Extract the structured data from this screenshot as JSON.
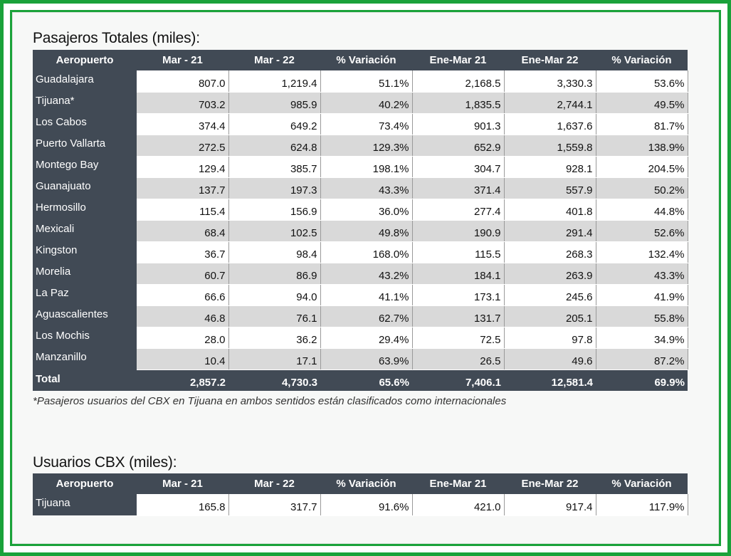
{
  "table1": {
    "title": "Pasajeros Totales (miles):",
    "headers": [
      "Aeropuerto",
      "Mar - 21",
      "Mar - 22",
      "% Variación",
      "Ene-Mar 21",
      "Ene-Mar 22",
      "% Variación"
    ],
    "rows": [
      [
        "Guadalajara",
        "807.0",
        "1,219.4",
        "51.1%",
        "2,168.5",
        "3,330.3",
        "53.6%"
      ],
      [
        "Tijuana*",
        "703.2",
        "985.9",
        "40.2%",
        "1,835.5",
        "2,744.1",
        "49.5%"
      ],
      [
        "Los Cabos",
        "374.4",
        "649.2",
        "73.4%",
        "901.3",
        "1,637.6",
        "81.7%"
      ],
      [
        "Puerto Vallarta",
        "272.5",
        "624.8",
        "129.3%",
        "652.9",
        "1,559.8",
        "138.9%"
      ],
      [
        "Montego Bay",
        "129.4",
        "385.7",
        "198.1%",
        "304.7",
        "928.1",
        "204.5%"
      ],
      [
        "Guanajuato",
        "137.7",
        "197.3",
        "43.3%",
        "371.4",
        "557.9",
        "50.2%"
      ],
      [
        "Hermosillo",
        "115.4",
        "156.9",
        "36.0%",
        "277.4",
        "401.8",
        "44.8%"
      ],
      [
        "Mexicali",
        "68.4",
        "102.5",
        "49.8%",
        "190.9",
        "291.4",
        "52.6%"
      ],
      [
        "Kingston",
        "36.7",
        "98.4",
        "168.0%",
        "115.5",
        "268.3",
        "132.4%"
      ],
      [
        "Morelia",
        "60.7",
        "86.9",
        "43.2%",
        "184.1",
        "263.9",
        "43.3%"
      ],
      [
        "La Paz",
        "66.6",
        "94.0",
        "41.1%",
        "173.1",
        "245.6",
        "41.9%"
      ],
      [
        "Aguascalientes",
        "46.8",
        "76.1",
        "62.7%",
        "131.7",
        "205.1",
        "55.8%"
      ],
      [
        "Los Mochis",
        "28.0",
        "36.2",
        "29.4%",
        "72.5",
        "97.8",
        "34.9%"
      ],
      [
        "Manzanillo",
        "10.4",
        "17.1",
        "63.9%",
        "26.5",
        "49.6",
        "87.2%"
      ]
    ],
    "total": [
      "Total",
      "2,857.2",
      "4,730.3",
      "65.6%",
      "7,406.1",
      "12,581.4",
      "69.9%"
    ],
    "footnote": "*Pasajeros usuarios del CBX en Tijuana en ambos sentidos están clasificados como internacionales"
  },
  "table2": {
    "title": "Usuarios CBX (miles):",
    "headers": [
      "Aeropuerto",
      "Mar - 21",
      "Mar - 22",
      "% Variación",
      "Ene-Mar 21",
      "Ene-Mar 22",
      "% Variación"
    ],
    "rows": [
      [
        "Tijuana",
        "165.8",
        "317.7",
        "91.6%",
        "421.0",
        "917.4",
        "117.9%"
      ]
    ]
  },
  "colors": {
    "frame_green": "#1aa23a",
    "header_dark": "#414a55",
    "row_alt_gray": "#d9d9d9"
  }
}
